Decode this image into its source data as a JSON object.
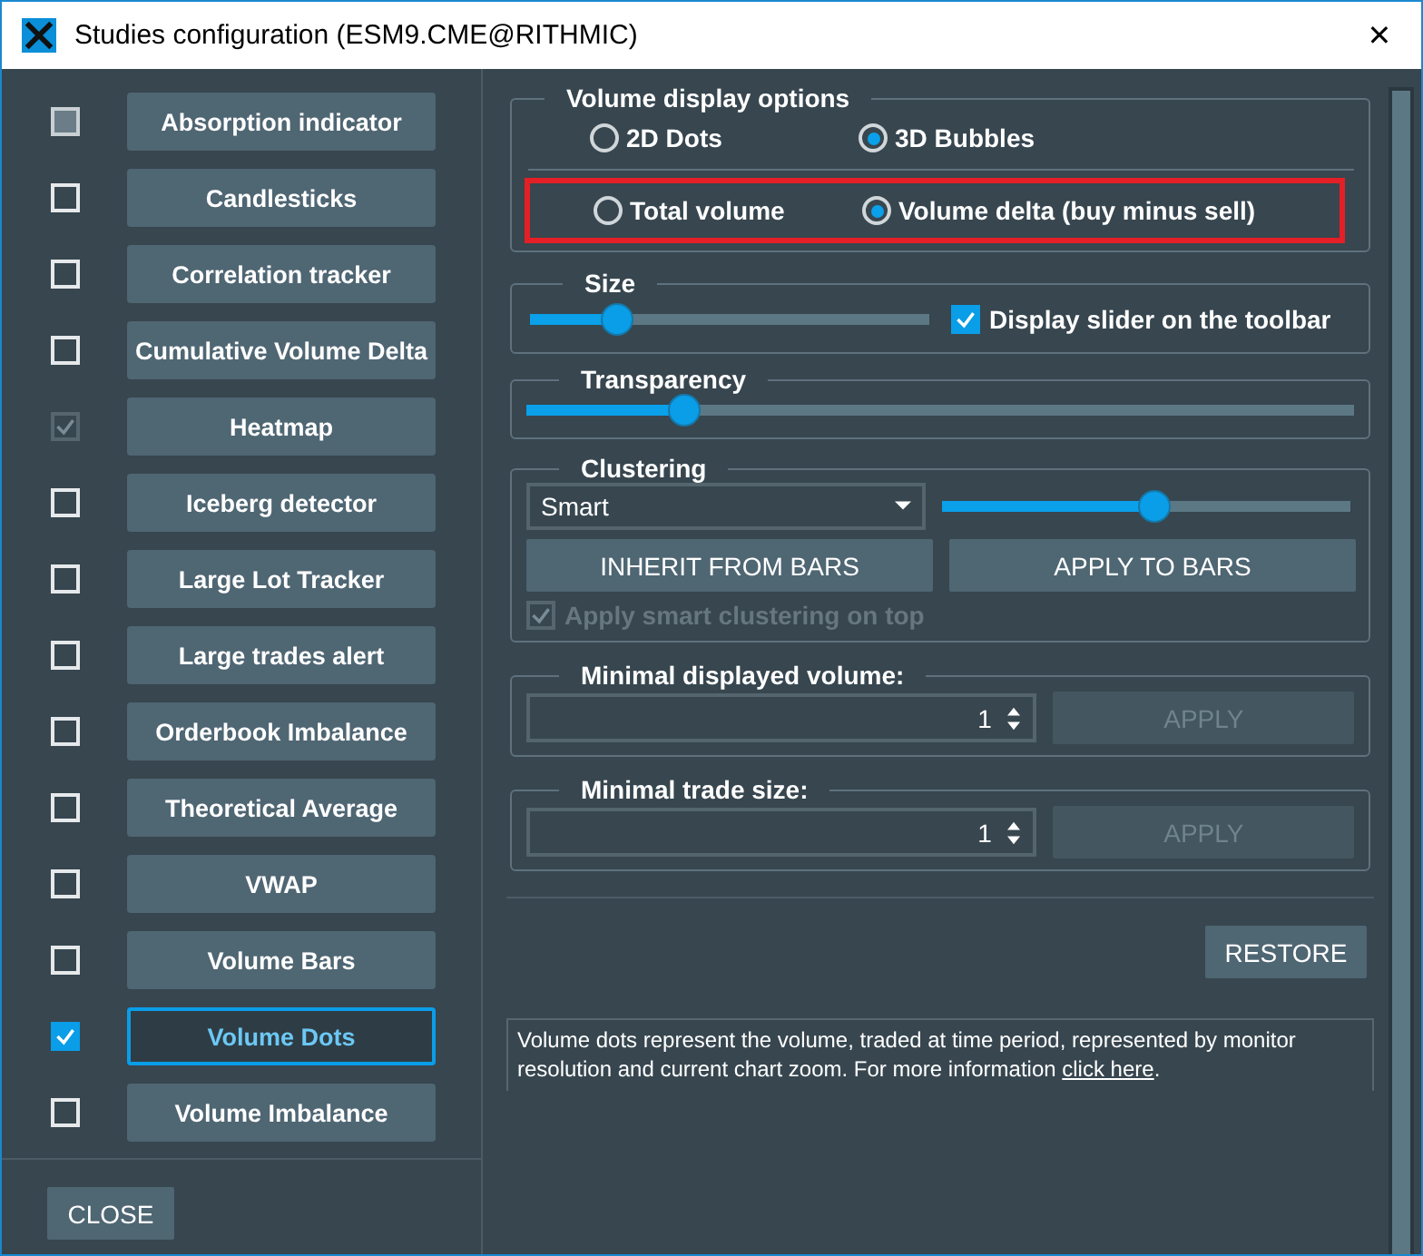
{
  "window": {
    "title": "Studies configuration (ESM9.CME@RITHMIC)",
    "close": "✕"
  },
  "studies": [
    {
      "label": "Absorption indicator",
      "checked": false,
      "mixed": true,
      "disabled": false,
      "selected": false
    },
    {
      "label": "Candlesticks",
      "checked": false,
      "mixed": false,
      "disabled": false,
      "selected": false
    },
    {
      "label": "Correlation tracker",
      "checked": false,
      "mixed": false,
      "disabled": false,
      "selected": false
    },
    {
      "label": "Cumulative Volume Delta",
      "checked": false,
      "mixed": false,
      "disabled": false,
      "selected": false
    },
    {
      "label": "Heatmap",
      "checked": true,
      "mixed": false,
      "disabled": true,
      "selected": false
    },
    {
      "label": "Iceberg detector",
      "checked": false,
      "mixed": false,
      "disabled": false,
      "selected": false
    },
    {
      "label": "Large Lot Tracker",
      "checked": false,
      "mixed": false,
      "disabled": false,
      "selected": false
    },
    {
      "label": "Large trades alert",
      "checked": false,
      "mixed": false,
      "disabled": false,
      "selected": false
    },
    {
      "label": "Orderbook Imbalance",
      "checked": false,
      "mixed": false,
      "disabled": false,
      "selected": false
    },
    {
      "label": "Theoretical Average",
      "checked": false,
      "mixed": false,
      "disabled": false,
      "selected": false
    },
    {
      "label": "VWAP",
      "checked": false,
      "mixed": false,
      "disabled": false,
      "selected": false
    },
    {
      "label": "Volume Bars",
      "checked": false,
      "mixed": false,
      "disabled": false,
      "selected": false
    },
    {
      "label": "Volume Dots",
      "checked": true,
      "mixed": false,
      "disabled": false,
      "selected": true
    },
    {
      "label": "Volume Imbalance",
      "checked": false,
      "mixed": false,
      "disabled": false,
      "selected": false
    }
  ],
  "close_button": "CLOSE",
  "volume_display": {
    "title": "Volume display options",
    "style_options": [
      {
        "label": "2D Dots",
        "selected": false
      },
      {
        "label": "3D Bubbles",
        "selected": true
      }
    ],
    "value_options": [
      {
        "label": "Total volume",
        "selected": false
      },
      {
        "label": "Volume delta (buy minus sell)",
        "selected": true
      }
    ],
    "value_options_highlighted": true
  },
  "size": {
    "title": "Size",
    "level": 0.22,
    "toolbar_checkbox": {
      "label": "Display slider on the toolbar",
      "checked": true
    }
  },
  "transparency": {
    "title": "Transparency",
    "level": 0.19
  },
  "clustering": {
    "title": "Clustering",
    "mode": "Smart",
    "level": 0.52,
    "buttons": [
      "INHERIT FROM BARS",
      "APPLY TO BARS"
    ],
    "smart_checkbox": {
      "label": "Apply smart clustering on top",
      "checked": true,
      "disabled": true
    }
  },
  "spin_groups": [
    {
      "title": "Minimal displayed volume:",
      "value": "1",
      "button": "APPLY",
      "disabled": true
    },
    {
      "title": "Minimal trade size:",
      "value": "1",
      "button": "APPLY",
      "disabled": true
    }
  ],
  "restore_button": "RESTORE",
  "description": {
    "text": "Volume dots represent the volume, traded at time period, represented by monitor resolution and current chart zoom. For more information",
    "link": "click here",
    "end": "."
  }
}
